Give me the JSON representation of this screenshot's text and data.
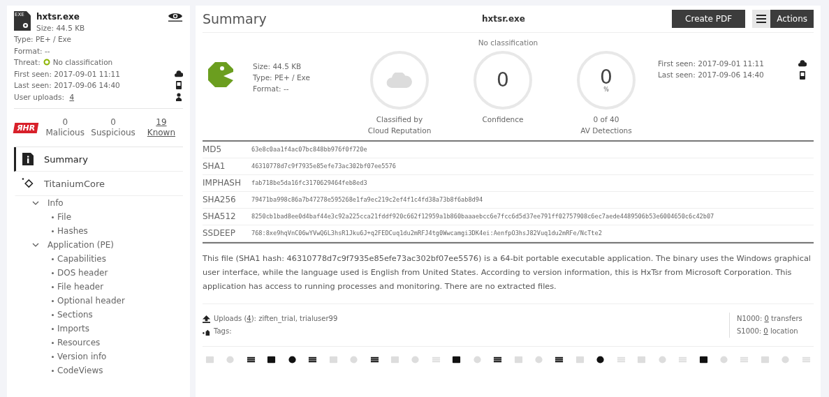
{
  "sidebar": {
    "file": {
      "name": "hxtsr.exe",
      "badge": "EXE",
      "size": "Size: 44.5 KB",
      "type": "Type: PE+ / Exe",
      "format": "Format: --",
      "threat_label": "Threat:",
      "threat": "No classification",
      "first_seen": "First seen: 2017-09-01 11:11",
      "last_seen": "Last seen: 2017-09-06 14:40",
      "uploads_label": "User uploads:",
      "uploads_count": "4"
    },
    "logo": "ЯHR",
    "stats": [
      {
        "value": "0",
        "label": "Malicious",
        "link": false
      },
      {
        "value": "0",
        "label": "Suspicious",
        "link": false
      },
      {
        "value": "19",
        "label": "Known",
        "link": true
      }
    ],
    "nav": [
      {
        "label": "Summary",
        "kind": "info",
        "selected": true
      },
      {
        "label": "TitaniumCore",
        "kind": "titanium",
        "selected": false
      }
    ],
    "tree": [
      {
        "label": "Info",
        "expanded": true,
        "children": [
          {
            "label": "File"
          },
          {
            "label": "Hashes"
          }
        ]
      },
      {
        "label": "Application (PE)",
        "expanded": true,
        "children": [
          {
            "label": "Capabilities"
          },
          {
            "label": "DOS header"
          },
          {
            "label": "File header"
          },
          {
            "label": "Optional header"
          },
          {
            "label": "Sections"
          },
          {
            "label": "Imports"
          },
          {
            "label": "Resources"
          },
          {
            "label": "Version info"
          },
          {
            "label": "CodeViews"
          }
        ]
      }
    ]
  },
  "main": {
    "title": "Summary",
    "filename": "hxtsr.exe",
    "buttons": [
      {
        "label": "Create PDF",
        "kind": "plain"
      },
      {
        "label": "Actions",
        "kind": "menu"
      }
    ],
    "classification": "No classification",
    "details": [
      "Size: 44.5 KB",
      "Type: PE+ / Exe",
      "Format: --"
    ],
    "gauges": [
      {
        "kind": "icon",
        "lines": [
          "Classified by",
          "Cloud Reputation"
        ]
      },
      {
        "kind": "value",
        "value": "0",
        "lines": [
          "Confidence"
        ]
      },
      {
        "kind": "value",
        "value": "0",
        "unit": "%",
        "lines": [
          "0 of 40",
          "AV Detections"
        ]
      }
    ],
    "dates": [
      "First seen: 2017-09-01 11:11",
      "Last seen: 2017-09-06 14:40"
    ],
    "hashes": [
      {
        "name": "MD5",
        "value": "63e8c0aa1f4ac07bc848bb976f0f720e"
      },
      {
        "name": "SHA1",
        "value": "46310778d7c9f7935e85efe73ac302bf07ee5576"
      },
      {
        "name": "IMPHASH",
        "value": "fab718be5da16fc3170629464feb8ed3"
      },
      {
        "name": "SHA256",
        "value": "79471ba998c86a7b47278e595268e1fa9ec219c2ef4f1c4fd38a73b8f6ab8d94"
      },
      {
        "name": "SHA512",
        "value": "8250cb1bad8ee0d4baf44e3c92a225cca21fddf920c662f12959a1b860baaaebcc6e7fcc6d5d37ee791ff02757908c6ec7aede4489506b53e6004650c6c42b07"
      },
      {
        "name": "SSDEEP",
        "value": "768:8xe9hqVnC06wYVwQ6L3hsR1Jku6J+q2FEDCuq1du2mRFJ4tg0Wwcamgi3DK4ei:AenfpO3hsJ82Vuq1du2mRFe/NcTte2"
      }
    ],
    "description": "This file (SHA1 hash: 46310778d7c9f7935e85efe73ac302bf07ee5576) is a 64-bit portable executable application. The binary uses the Windows graphical user interface, while the language used is English from United States. According to version information, this is HxTsr from Microsoft Corporation. This application has access to running processes and monitoring. There are no extracted files.",
    "uploads": {
      "prefix": "Uploads (",
      "count": "4",
      "suffix": "): ziften_trial, trialuser99"
    },
    "tags_label": "Tags:",
    "counters": [
      {
        "label": "N1000:",
        "count": "0",
        "suffix": " transfers"
      },
      {
        "label": "S1000:",
        "count": "0",
        "suffix": " location"
      }
    ],
    "capabilities": [
      {
        "active": false
      },
      {
        "active": false
      },
      {
        "active": true
      },
      {
        "active": true
      },
      {
        "active": true
      },
      {
        "active": true
      },
      {
        "active": false
      },
      {
        "active": false
      },
      {
        "active": true
      },
      {
        "active": false
      },
      {
        "active": false
      },
      {
        "active": false
      },
      {
        "active": true
      },
      {
        "active": false
      },
      {
        "active": true
      },
      {
        "active": false
      },
      {
        "active": false
      },
      {
        "active": true
      },
      {
        "active": false
      },
      {
        "active": true
      },
      {
        "active": false
      },
      {
        "active": false
      },
      {
        "active": false
      },
      {
        "active": false
      },
      {
        "active": true
      },
      {
        "active": false
      },
      {
        "active": false
      },
      {
        "active": false
      },
      {
        "active": false
      },
      {
        "active": false
      }
    ]
  }
}
